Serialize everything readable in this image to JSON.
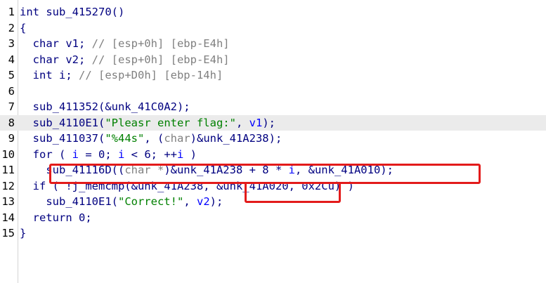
{
  "code": {
    "lines": [
      {
        "n": "1",
        "parts": [
          {
            "t": "int sub_415270()",
            "c": "kw"
          }
        ]
      },
      {
        "n": "2",
        "parts": [
          {
            "t": "{",
            "c": "kw"
          }
        ]
      },
      {
        "n": "3",
        "parts": [
          {
            "t": "  char v1; ",
            "c": "kw"
          },
          {
            "t": "// [esp+0h] [ebp-E4h]",
            "c": "cmt"
          }
        ]
      },
      {
        "n": "4",
        "parts": [
          {
            "t": "  char v2; ",
            "c": "kw"
          },
          {
            "t": "// [esp+0h] [ebp-E4h]",
            "c": "cmt"
          }
        ]
      },
      {
        "n": "5",
        "parts": [
          {
            "t": "  int i; ",
            "c": "kw"
          },
          {
            "t": "// [esp+D0h] [ebp-14h]",
            "c": "cmt"
          }
        ]
      },
      {
        "n": "6",
        "parts": [
          {
            "t": "",
            "c": "kw"
          }
        ]
      },
      {
        "n": "7",
        "parts": [
          {
            "t": "  sub_411352(&unk_41C0A2);",
            "c": "kw"
          }
        ]
      },
      {
        "n": "8",
        "hl": true,
        "parts": [
          {
            "t": "  sub_4110E1(",
            "c": "kw"
          },
          {
            "t": "\"Pleasr enter flag:\"",
            "c": "str"
          },
          {
            "t": ", ",
            "c": "kw"
          },
          {
            "t": "v1",
            "c": "var"
          },
          {
            "t": ");",
            "c": "kw"
          }
        ]
      },
      {
        "n": "9",
        "parts": [
          {
            "t": "  sub_411037(",
            "c": "kw"
          },
          {
            "t": "\"%44s\"",
            "c": "str"
          },
          {
            "t": ", (",
            "c": "kw"
          },
          {
            "t": "char",
            "c": "dim"
          },
          {
            "t": ")&unk_41A238);",
            "c": "kw"
          }
        ]
      },
      {
        "n": "10",
        "parts": [
          {
            "t": "  for ( ",
            "c": "kw"
          },
          {
            "t": "i",
            "c": "var"
          },
          {
            "t": " = 0; ",
            "c": "kw"
          },
          {
            "t": "i",
            "c": "var"
          },
          {
            "t": " < 6; ++",
            "c": "kw"
          },
          {
            "t": "i",
            "c": "var"
          },
          {
            "t": " )",
            "c": "kw"
          }
        ]
      },
      {
        "n": "11",
        "parts": [
          {
            "t": "    sub_41116D((",
            "c": "kw"
          },
          {
            "t": "char *",
            "c": "dim"
          },
          {
            "t": ")&unk_41A238 + 8 * ",
            "c": "kw"
          },
          {
            "t": "i",
            "c": "var"
          },
          {
            "t": ", &unk_41A010);",
            "c": "kw"
          }
        ]
      },
      {
        "n": "12",
        "parts": [
          {
            "t": "  if ( !j_memcmp(&unk_41A238, &unk_41A020, 0x2Cu) )",
            "c": "kw"
          }
        ]
      },
      {
        "n": "13",
        "parts": [
          {
            "t": "    sub_4110E1(",
            "c": "kw"
          },
          {
            "t": "\"Correct!\"",
            "c": "str"
          },
          {
            "t": ", ",
            "c": "kw"
          },
          {
            "t": "v2",
            "c": "var"
          },
          {
            "t": ");",
            "c": "kw"
          }
        ]
      },
      {
        "n": "14",
        "parts": [
          {
            "t": "  return 0;",
            "c": "kw"
          }
        ]
      },
      {
        "n": "15",
        "parts": [
          {
            "t": "}",
            "c": "kw"
          }
        ]
      }
    ]
  },
  "annotations": {
    "box_color": "#e31b1b"
  }
}
